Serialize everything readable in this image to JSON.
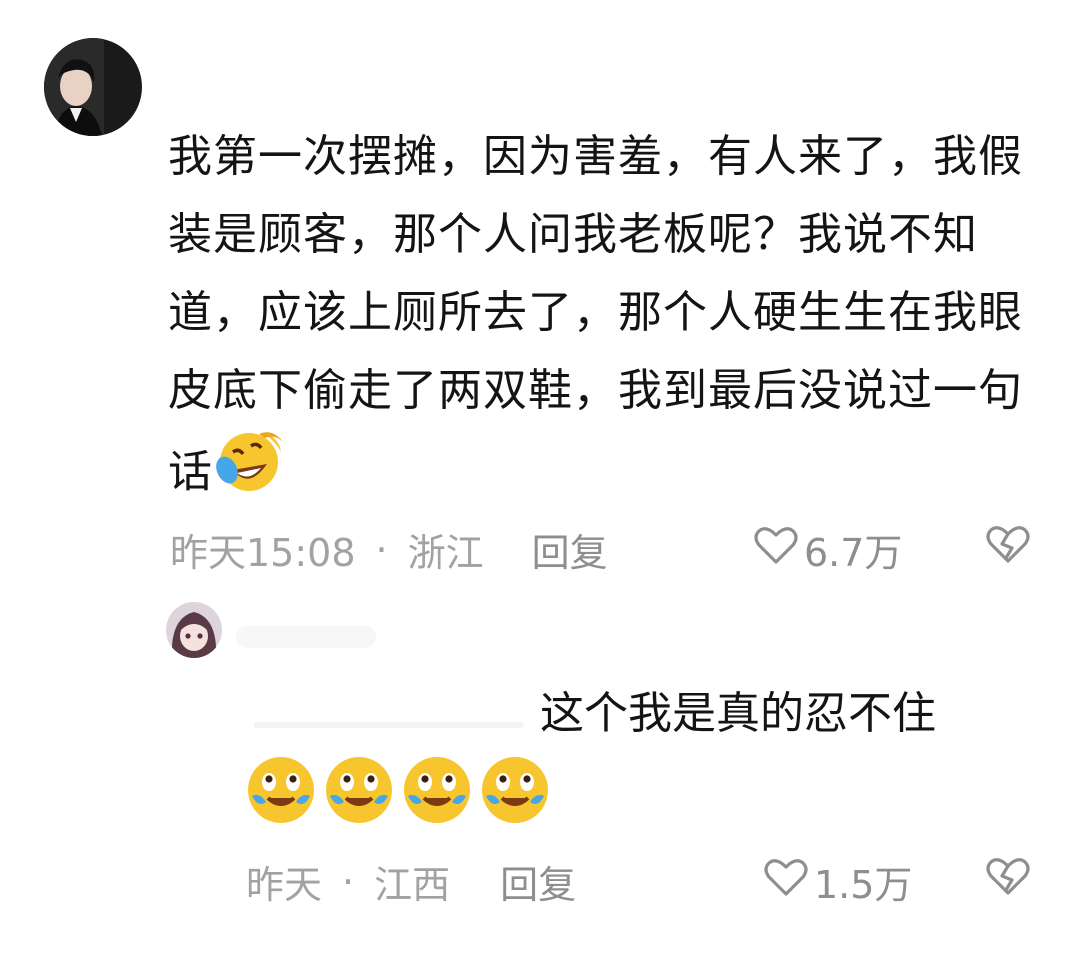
{
  "comments": [
    {
      "text": "我第一次摆摊，因为害羞，有人来了，我假装是顾客，那个人问我老板呢？我说不知道，应该上厕所去了，那个人硬生生在我眼皮底下偷走了两双鞋，我到最后没说过一句话",
      "emoji": "rolling-on-floor-laughing-emoji",
      "time": "昨天15:08",
      "location": "浙江",
      "reply_label": "回复",
      "likes": "6.7万"
    },
    {
      "text": "这个我是真的忍不住",
      "emoji": "crying-laughing-emoji",
      "emoji_count": 4,
      "time": "昨天",
      "location": "江西",
      "reply_label": "回复",
      "likes": "1.5万"
    }
  ],
  "separator": "·",
  "colors": {
    "text": "#141414",
    "meta": "#a2a2a2",
    "icon": "#8e8e8e"
  }
}
